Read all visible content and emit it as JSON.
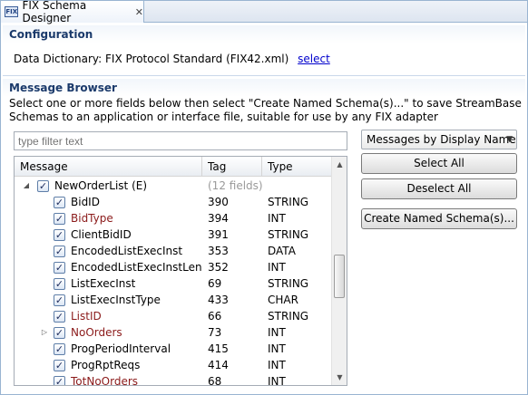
{
  "tab": {
    "title": "FIX Schema Designer",
    "close": "✕",
    "icon_text": "FIX"
  },
  "configuration": {
    "title": "Configuration",
    "dd_label": "Data Dictionary:",
    "dd_value": "FIX Protocol Standard (FIX42.xml)",
    "select_link": "select"
  },
  "message_browser": {
    "title": "Message Browser",
    "description": "Select one or more fields below then select \"Create Named Schema(s)...\" to save StreamBase Schemas to an application or interface file, suitable for use by any FIX adapter",
    "filter_placeholder": "type filter text",
    "sort_select": "Messages by Display Name",
    "columns": {
      "message": "Message",
      "tag": "Tag",
      "type": "Type"
    },
    "group": {
      "name": "NewOrderList (E)",
      "fields": "(12 fields)",
      "checked": true,
      "expanded": true
    },
    "rows": [
      {
        "name": "BidID",
        "tag": "390",
        "type": "STRING",
        "required": false,
        "checked": true,
        "expandable": false
      },
      {
        "name": "BidType",
        "tag": "394",
        "type": "INT",
        "required": true,
        "checked": true,
        "expandable": false
      },
      {
        "name": "ClientBidID",
        "tag": "391",
        "type": "STRING",
        "required": false,
        "checked": true,
        "expandable": false
      },
      {
        "name": "EncodedListExecInst",
        "tag": "353",
        "type": "DATA",
        "required": false,
        "checked": true,
        "expandable": false
      },
      {
        "name": "EncodedListExecInstLen",
        "tag": "352",
        "type": "INT",
        "required": false,
        "checked": true,
        "expandable": false
      },
      {
        "name": "ListExecInst",
        "tag": "69",
        "type": "STRING",
        "required": false,
        "checked": true,
        "expandable": false
      },
      {
        "name": "ListExecInstType",
        "tag": "433",
        "type": "CHAR",
        "required": false,
        "checked": true,
        "expandable": false
      },
      {
        "name": "ListID",
        "tag": "66",
        "type": "STRING",
        "required": true,
        "checked": true,
        "expandable": false
      },
      {
        "name": "NoOrders",
        "tag": "73",
        "type": "INT",
        "required": true,
        "checked": true,
        "expandable": true
      },
      {
        "name": "ProgPeriodInterval",
        "tag": "415",
        "type": "INT",
        "required": false,
        "checked": true,
        "expandable": false
      },
      {
        "name": "ProgRptReqs",
        "tag": "414",
        "type": "INT",
        "required": false,
        "checked": true,
        "expandable": false
      },
      {
        "name": "TotNoOrders",
        "tag": "68",
        "type": "INT",
        "required": true,
        "checked": true,
        "expandable": false
      }
    ]
  },
  "buttons": {
    "select_all": "Select All",
    "deselect_all": "Deselect All",
    "create_schema": "Create Named Schema(s)..."
  },
  "colors": {
    "required_field": "#8b1a1a",
    "section_title": "#1b3a6b",
    "link": "#0000cc"
  }
}
